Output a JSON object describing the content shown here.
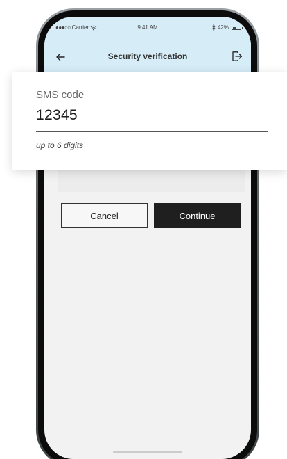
{
  "status_bar": {
    "signal": "●●●○○",
    "carrier": "Carrier",
    "wifi_icon": "wifi-icon",
    "time": "9:41 AM",
    "bluetooth_icon": "bluetooth-icon",
    "battery_percent": "42%",
    "battery_level": 0.42
  },
  "nav": {
    "title": "Security verification",
    "back_icon": "arrow-left-icon",
    "exit_icon": "logout-icon"
  },
  "sms_field": {
    "label": "SMS code",
    "value": "12345",
    "hint": "up to 6 digits"
  },
  "actions": {
    "cancel_label": "Cancel",
    "continue_label": "Continue"
  },
  "colors": {
    "header_bg": "#d6ecf7",
    "primary_button": "#1f1f1f",
    "screen_bg": "#f2f2f2"
  }
}
